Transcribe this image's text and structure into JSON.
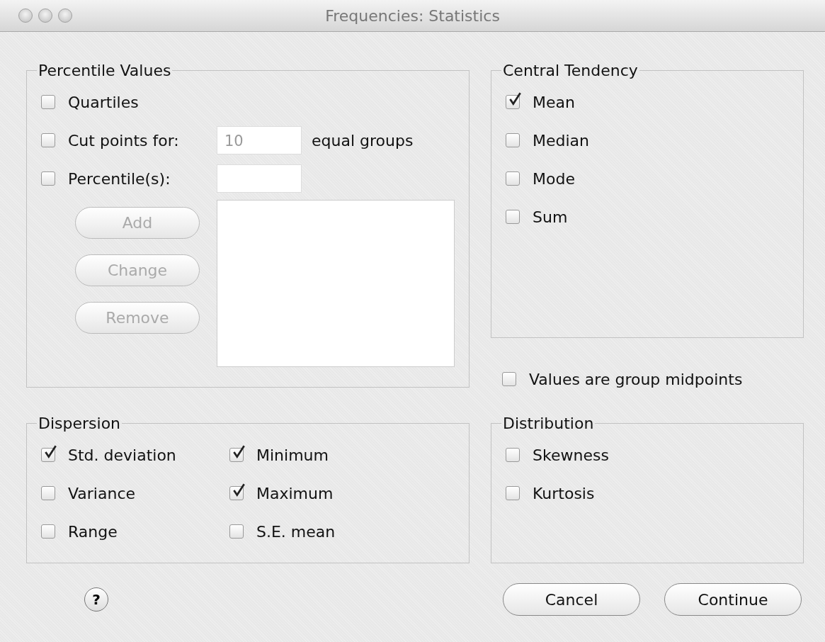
{
  "window": {
    "title": "Frequencies: Statistics"
  },
  "percentile_values": {
    "title": "Percentile Values",
    "options": [
      {
        "kind": "plain",
        "label": "Quartiles",
        "checked": false
      },
      {
        "kind": "cut-points",
        "label": "Cut points for:",
        "checked": false,
        "value": "10",
        "value_disabled": true,
        "suffix": "equal groups"
      },
      {
        "kind": "percentiles",
        "label": "Percentile(s):",
        "checked": false
      }
    ],
    "buttons": [
      {
        "label": "Add",
        "disabled": true
      },
      {
        "label": "Change",
        "disabled": true
      },
      {
        "label": "Remove",
        "disabled": true
      }
    ]
  },
  "central_tendency": {
    "title": "Central Tendency",
    "options": [
      {
        "label": "Mean",
        "checked": true
      },
      {
        "label": "Median",
        "checked": false
      },
      {
        "label": "Mode",
        "checked": false
      },
      {
        "label": "Sum",
        "checked": false
      }
    ]
  },
  "group_midpoints": {
    "label": "Values are group midpoints",
    "checked": false
  },
  "dispersion": {
    "title": "Dispersion",
    "options": [
      {
        "label": "Std. deviation",
        "checked": true
      },
      {
        "label": "Variance",
        "checked": false
      },
      {
        "label": "Range",
        "checked": false
      },
      {
        "label": "Minimum",
        "checked": true
      },
      {
        "label": "Maximum",
        "checked": true
      },
      {
        "label": "S.E. mean",
        "checked": false
      }
    ]
  },
  "distribution": {
    "title": "Distribution",
    "options": [
      {
        "label": "Skewness",
        "checked": false
      },
      {
        "label": "Kurtosis",
        "checked": false
      }
    ]
  },
  "help": {
    "label": "?"
  },
  "buttons": [
    {
      "label": "Cancel"
    },
    {
      "label": "Continue"
    }
  ]
}
